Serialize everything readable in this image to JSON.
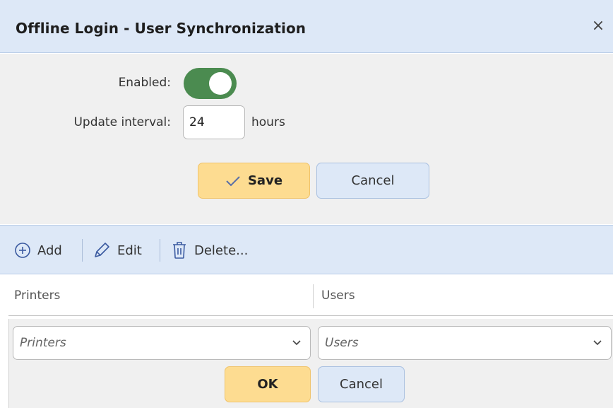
{
  "dialog": {
    "title": "Offline Login - User Synchronization",
    "close_symbol": "×"
  },
  "settings": {
    "enabled_label": "Enabled:",
    "enabled": true,
    "interval_label": "Update interval:",
    "interval_value": "24",
    "interval_unit": "hours",
    "save_label": "Save",
    "cancel_label": "Cancel"
  },
  "toolbar": {
    "add_label": "Add",
    "edit_label": "Edit",
    "delete_label": "Delete..."
  },
  "grid": {
    "columns": [
      "Printers",
      "Users"
    ],
    "edit_row": {
      "printers_placeholder": "Printers",
      "users_placeholder": "Users",
      "ok_label": "OK",
      "cancel_label": "Cancel"
    }
  },
  "icons": {
    "close": "close-icon",
    "save": "check-icon",
    "add": "plus-circle-icon",
    "edit": "pencil-icon",
    "delete": "trash-icon",
    "dropdown": "chevron-down-icon"
  },
  "colors": {
    "header_bg": "#dde8f7",
    "panel_bg": "#f0f0f0",
    "toggle_on": "#4b8b50",
    "primary_button": "#fddc91",
    "secondary_button": "#dde8f7"
  }
}
